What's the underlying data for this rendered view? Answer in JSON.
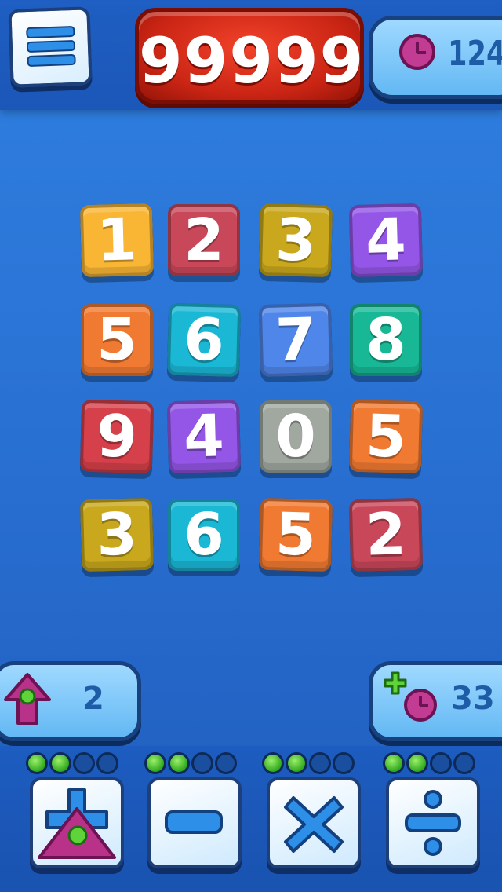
{
  "hud": {
    "menu_icon": "hamburger-menu-icon",
    "score": "99999",
    "timer_icon": "clock-icon",
    "timer_value": "124"
  },
  "grid": {
    "rows": [
      [
        {
          "value": "1",
          "color": "#f9b634"
        },
        {
          "value": "2",
          "color": "#c8485a"
        },
        {
          "value": "3",
          "color": "#c9a81d"
        },
        {
          "value": "4",
          "color": "#9356e6"
        }
      ],
      [
        {
          "value": "5",
          "color": "#f17a33"
        },
        {
          "value": "6",
          "color": "#1bb8d6"
        },
        {
          "value": "7",
          "color": "#4f86ea"
        },
        {
          "value": "8",
          "color": "#18b896"
        }
      ],
      [
        {
          "value": "9",
          "color": "#d5404b"
        },
        {
          "value": "4",
          "color": "#9356e6"
        },
        {
          "value": "0",
          "color": "#a0a8a0"
        },
        {
          "value": "5",
          "color": "#f17a33"
        }
      ],
      [
        {
          "value": "3",
          "color": "#c9a81d"
        },
        {
          "value": "6",
          "color": "#1bb8d6"
        },
        {
          "value": "5",
          "color": "#f17a33"
        },
        {
          "value": "2",
          "color": "#c8485a"
        }
      ]
    ]
  },
  "left_panel": {
    "icon": "up-arrow-icon",
    "value": "2"
  },
  "right_panel": {
    "icon": "plus-clock-icon",
    "value": "33"
  },
  "progress_dots": [
    {
      "filled": true
    },
    {
      "filled": true
    },
    {
      "filled": false
    },
    {
      "filled": false
    },
    {
      "filled": true
    },
    {
      "filled": true
    },
    {
      "filled": false
    },
    {
      "filled": false
    },
    {
      "filled": true
    },
    {
      "filled": true
    },
    {
      "filled": false
    },
    {
      "filled": false
    },
    {
      "filled": true
    },
    {
      "filled": true
    },
    {
      "filled": false
    },
    {
      "filled": false
    }
  ],
  "operators": [
    {
      "name": "plus",
      "icon": "plus-icon"
    },
    {
      "name": "minus",
      "icon": "minus-icon"
    },
    {
      "name": "multiply",
      "icon": "multiply-icon"
    },
    {
      "name": "divide",
      "icon": "divide-icon"
    }
  ],
  "colors": {
    "hud_blue": "#1f5ec2",
    "score_red": "#d52a18",
    "panel_blue": "#7fc6f8",
    "dot_green": "#2fa81e",
    "marker_magenta": "#b8328a"
  }
}
